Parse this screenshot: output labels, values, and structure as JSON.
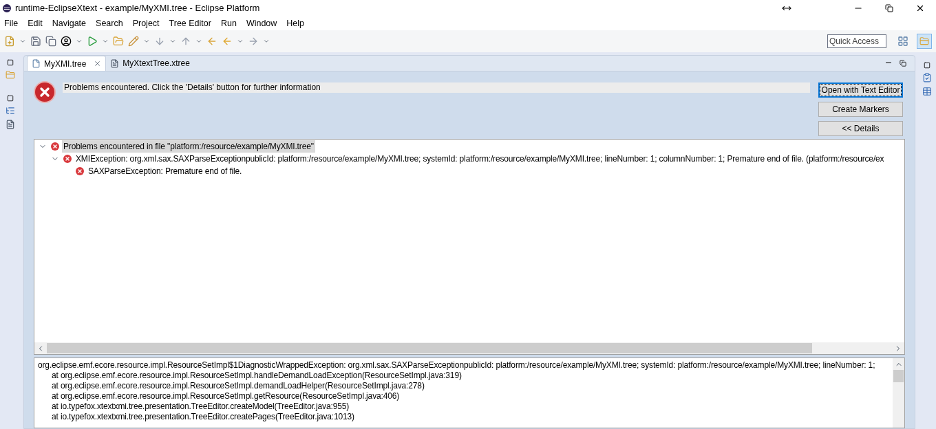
{
  "window": {
    "title": "runtime-EclipseXtext - example/MyXMI.tree - Eclipse Platform"
  },
  "menu": [
    "File",
    "Edit",
    "Navigate",
    "Search",
    "Project",
    "Tree Editor",
    "Run",
    "Window",
    "Help"
  ],
  "quick_access": {
    "placeholder": "Quick Access"
  },
  "tabs": [
    {
      "label": "MyXMI.tree",
      "selected": true,
      "kind": "tree"
    },
    {
      "label": "MyXtextTree.xtree",
      "selected": false,
      "kind": "text"
    }
  ],
  "message": "Problems encountered.  Click the 'Details' button for further information",
  "buttons": [
    {
      "label": "Open with Text Editor",
      "focused": true
    },
    {
      "label": "Create Markers",
      "focused": false
    },
    {
      "label": "<< Details",
      "focused": false
    }
  ],
  "problems": [
    {
      "text": "Problems encountered in file \"platform:/resource/example/MyXMI.tree\"",
      "selected": true,
      "expanded": true,
      "children": [
        {
          "text": "XMIException: org.xml.sax.SAXParseExceptionpublicId: platform:/resource/example/MyXMI.tree; systemId: platform:/resource/example/MyXMI.tree; lineNumber: 1; columnNumber: 1; Premature end of file. (platform:/resource/ex",
          "selected": false,
          "expanded": true,
          "children": [
            {
              "text": "SAXParseException: Premature end of file.",
              "selected": false
            }
          ]
        }
      ]
    }
  ],
  "details": [
    {
      "kind": "exception",
      "text": "org.eclipse.emf.ecore.resource.impl.ResourceSetImpl$1DiagnosticWrappedException: org.xml.sax.SAXParseExceptionpublicId: platform:/resource/example/MyXMI.tree; systemId: platform:/resource/example/MyXMI.tree; lineNumber: 1;"
    },
    {
      "kind": "frame",
      "text": "at org.eclipse.emf.ecore.resource.impl.ResourceSetImpl.handleDemandLoadException(ResourceSetImpl.java:319)"
    },
    {
      "kind": "frame",
      "text": "at org.eclipse.emf.ecore.resource.impl.ResourceSetImpl.demandLoadHelper(ResourceSetImpl.java:278)"
    },
    {
      "kind": "frame",
      "text": "at org.eclipse.emf.ecore.resource.impl.ResourceSetImpl.getResource(ResourceSetImpl.java:406)"
    },
    {
      "kind": "frame",
      "text": "at io.typefox.xtextxmi.tree.presentation.TreeEditor.createModel(TreeEditor.java:955)"
    },
    {
      "kind": "frame",
      "text": "at io.typefox.xtextxmi.tree.presentation.TreeEditor.createPages(TreeEditor.java:1013)"
    }
  ]
}
